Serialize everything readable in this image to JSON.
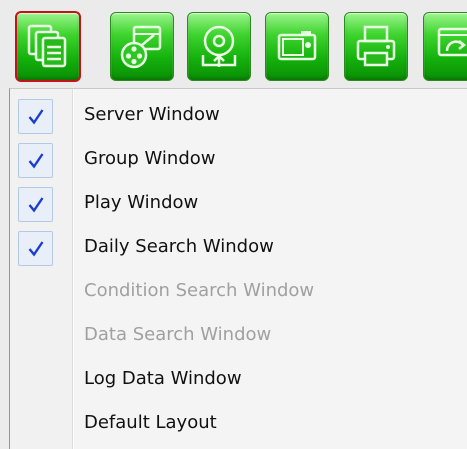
{
  "toolbar": {
    "buttons": [
      {
        "icon": "windows-stack-icon",
        "selected": true
      },
      {
        "icon": "film-reel-playback-icon",
        "selected": false
      },
      {
        "icon": "disk-upload-icon",
        "selected": false
      },
      {
        "icon": "camera-snapshot-icon",
        "selected": false
      },
      {
        "icon": "printer-icon",
        "selected": false
      },
      {
        "icon": "refresh-window-icon",
        "selected": false
      }
    ],
    "colors": {
      "button_green": "#14b10c",
      "selected_border": "#c4121a"
    }
  },
  "menu": {
    "items": [
      {
        "label": "Server Window",
        "checked": true,
        "enabled": true
      },
      {
        "label": "Group Window",
        "checked": true,
        "enabled": true
      },
      {
        "label": "Play Window",
        "checked": true,
        "enabled": true
      },
      {
        "label": "Daily Search Window",
        "checked": true,
        "enabled": true
      },
      {
        "label": "Condition Search Window",
        "checked": false,
        "enabled": false
      },
      {
        "label": "Data Search Window",
        "checked": false,
        "enabled": false
      },
      {
        "label": "Log Data Window",
        "checked": false,
        "enabled": true
      },
      {
        "label": "Default Layout",
        "checked": false,
        "enabled": true
      }
    ],
    "colors": {
      "check": "#1a3fd0",
      "disabled_text": "#a0a0a0"
    }
  }
}
